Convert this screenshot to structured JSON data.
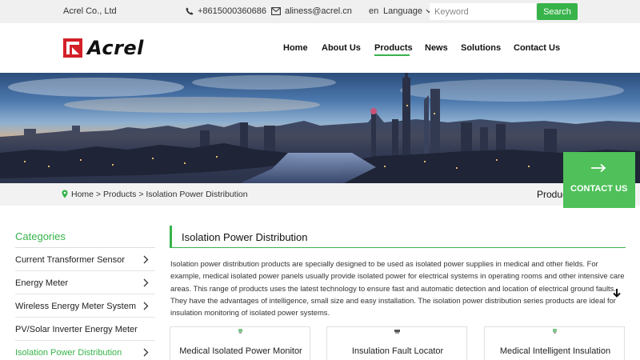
{
  "topbar": {
    "company": "Acrel Co., Ltd",
    "phone": "+8615000360686",
    "email": "aliness@acrel.cn",
    "lang_code": "en",
    "language_label": "Language",
    "search_placeholder": "Keyword",
    "search_button": "Search"
  },
  "header": {
    "logo_text": "Acrel",
    "nav": {
      "home": "Home",
      "about": "About Us",
      "products": "Products",
      "news": "News",
      "solutions": "Solutions",
      "contact": "Contact Us"
    },
    "active_nav": "Products"
  },
  "breadcrumb": {
    "path": "Home > Products > Isolation Power Distribution",
    "section": "Products"
  },
  "contact_float": {
    "label": "CONTACT US"
  },
  "sidebar": {
    "title": "Categories",
    "items": [
      {
        "label": "Current Transformer Sensor",
        "has_arrow": true
      },
      {
        "label": "Energy Meter",
        "has_arrow": true
      },
      {
        "label": "Wireless Energy Meter System",
        "has_arrow": true
      },
      {
        "label": "PV/Solar Inverter Energy Meter",
        "has_arrow": false
      },
      {
        "label": "Isolation Power Distribution",
        "has_arrow": true
      }
    ],
    "active_item": "Isolation Power Distribution"
  },
  "main": {
    "title": "Isolation Power Distribution",
    "description": "Isolation power distribution products are specially designed to be used as isolated power supplies in medical and other fields. For example, medical isolated power panels usually provide isolated power for electrical systems in operating rooms and other intensive care areas. This range of products uses the latest technology to ensure fast and automatic detection and location of electrical ground faults. They have the advantages of intelligence, small size and easy installation. The isolation power distribution series products are ideal for insulation monitoring of isolated power systems.",
    "cards": [
      {
        "title": "Medical Isolated Power Monitor"
      },
      {
        "title": "Insulation Fault Locator"
      },
      {
        "title": "Medical Intelligent Insulation"
      }
    ]
  },
  "colors": {
    "accent": "#37b34a",
    "logo_red": "#d42027",
    "topbar_bg": "#f0f0f0",
    "contact_green": "#4fc05a"
  },
  "icons": {
    "phone": "phone-icon",
    "mail": "mail-icon",
    "dropdown": "chevron-down-icon",
    "location": "location-pin-icon",
    "arrow_right": "arrow-right-icon",
    "chevron_right": "chevron-right-icon",
    "scroll_down": "arrow-down-icon"
  }
}
